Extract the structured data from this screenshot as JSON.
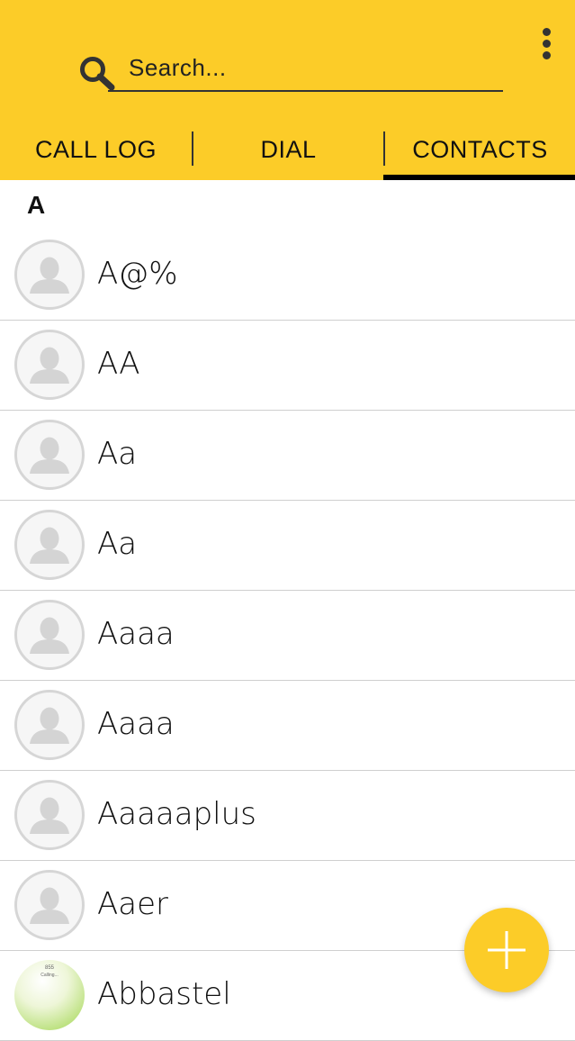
{
  "colors": {
    "header": "#fccc28",
    "fab": "#fccc28",
    "divider": "#cfcfcf"
  },
  "search": {
    "placeholder": "Search...",
    "icon": "search-icon"
  },
  "menu": {
    "icon": "more-vertical-icon"
  },
  "tabs": [
    {
      "label": "CALL LOG",
      "active": false
    },
    {
      "label": "DIAL",
      "active": false
    },
    {
      "label": "CONTACTS",
      "active": true
    }
  ],
  "section": {
    "letter": "A"
  },
  "contacts": [
    {
      "name": "A@%",
      "avatar": "default-avatar-icon"
    },
    {
      "name": "AA",
      "avatar": "default-avatar-icon"
    },
    {
      "name": "Aa",
      "avatar": "default-avatar-icon"
    },
    {
      "name": "Aa",
      "avatar": "default-avatar-icon"
    },
    {
      "name": "Aaaa",
      "avatar": "default-avatar-icon"
    },
    {
      "name": "Aaaa",
      "avatar": "default-avatar-icon"
    },
    {
      "name": "Aaaaaplus",
      "avatar": "default-avatar-icon"
    },
    {
      "name": "Aaer",
      "avatar": "default-avatar-icon"
    },
    {
      "name": "Abbastel",
      "avatar": "photo",
      "photo_number": "855",
      "photo_caption": "Calling..."
    }
  ],
  "fab": {
    "icon": "plus-icon"
  }
}
